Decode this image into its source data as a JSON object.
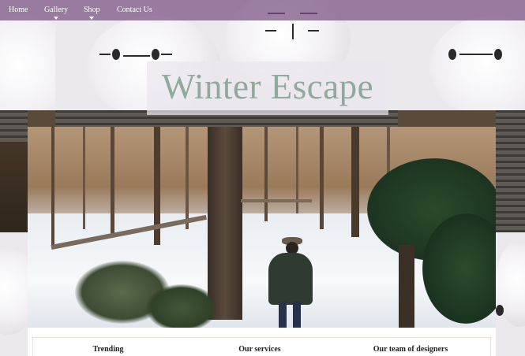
{
  "nav": {
    "items": [
      {
        "label": "Home",
        "has_dropdown": false
      },
      {
        "label": "Gallery",
        "has_dropdown": true
      },
      {
        "label": "Shop",
        "has_dropdown": true
      },
      {
        "label": "Contact Us",
        "has_dropdown": false
      }
    ]
  },
  "hero": {
    "title": "Winter Escape"
  },
  "sections": [
    {
      "heading": "Trending"
    },
    {
      "heading": "Our services"
    },
    {
      "heading": "Our team of designers"
    }
  ],
  "colors": {
    "nav_bg": "#785082",
    "title_text": "#6e9682",
    "panel_bg": "#ffffff"
  }
}
